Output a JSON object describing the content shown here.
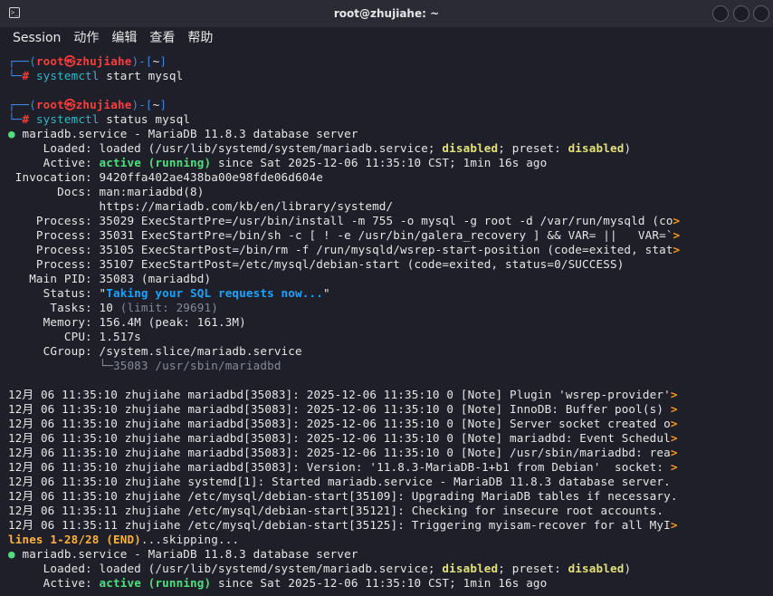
{
  "window": {
    "title": "root@zhujiahe: ~",
    "app_icon_glyph": ">_"
  },
  "menu": [
    "Session",
    "动作",
    "编辑",
    "查看",
    "帮助"
  ],
  "terminal": {
    "lines": [
      [
        {
          "t": "┌──(",
          "c": "blue"
        },
        {
          "t": "root㉿zhujiahe",
          "c": "red"
        },
        {
          "t": ")-[",
          "c": "blue"
        },
        {
          "t": "~",
          "c": ""
        },
        {
          "t": "]",
          "c": "blue"
        }
      ],
      [
        {
          "t": "└─",
          "c": "blue"
        },
        {
          "t": "# ",
          "c": "red"
        },
        {
          "t": "systemctl",
          "c": "cyan"
        },
        {
          "t": " start mysql",
          "c": ""
        }
      ],
      [],
      [
        {
          "t": "┌──(",
          "c": "blue"
        },
        {
          "t": "root㉿zhujiahe",
          "c": "red"
        },
        {
          "t": ")-[",
          "c": "blue"
        },
        {
          "t": "~",
          "c": ""
        },
        {
          "t": "]",
          "c": "blue"
        }
      ],
      [
        {
          "t": "└─",
          "c": "blue"
        },
        {
          "t": "# ",
          "c": "red"
        },
        {
          "t": "systemctl",
          "c": "cyan"
        },
        {
          "t": " status mysql",
          "c": ""
        }
      ],
      [
        {
          "t": "●",
          "c": "green"
        },
        {
          "t": " mariadb.service - MariaDB 11.8.3 database server",
          "c": ""
        }
      ],
      [
        {
          "t": "     Loaded: loaded (/usr/lib/systemd/system/mariadb.service; ",
          "c": ""
        },
        {
          "t": "disabled",
          "c": "yellowb"
        },
        {
          "t": "; preset: ",
          "c": ""
        },
        {
          "t": "disabled",
          "c": "yellowb"
        },
        {
          "t": ")",
          "c": ""
        }
      ],
      [
        {
          "t": "     Active: ",
          "c": ""
        },
        {
          "t": "active (running)",
          "c": "greenb"
        },
        {
          "t": " since Sat 2025-12-06 11:35:10 CST; 1min 16s ago",
          "c": ""
        }
      ],
      [
        {
          "t": " Invocation: 9420ffa402ae438ba00e98fde06d604e",
          "c": ""
        }
      ],
      [
        {
          "t": "       Docs: man:mariadbd(8)",
          "c": ""
        }
      ],
      [
        {
          "t": "             https://mariadb.com/kb/en/library/systemd/",
          "c": ""
        }
      ],
      [
        {
          "t": "    Process: 35029 ExecStartPre=/usr/bin/install -m 755 -o mysql -g root -d /var/run/mysqld (co",
          "c": ""
        },
        {
          "t": ">",
          "c": "orange"
        }
      ],
      [
        {
          "t": "    Process: 35031 ExecStartPre=/bin/sh -c [ ! -e /usr/bin/galera_recovery ] && VAR= ||   VAR=`",
          "c": ""
        },
        {
          "t": ">",
          "c": "orange"
        }
      ],
      [
        {
          "t": "    Process: 35105 ExecStartPost=/bin/rm -f /run/mysqld/wsrep-start-position (code=exited, stat",
          "c": ""
        },
        {
          "t": ">",
          "c": "orange"
        }
      ],
      [
        {
          "t": "    Process: 35107 ExecStartPost=/etc/mysql/debian-start (code=exited, status=0/SUCCESS)",
          "c": ""
        }
      ],
      [
        {
          "t": "   Main PID: 35083 (mariadbd)",
          "c": ""
        }
      ],
      [
        {
          "t": "     Status: \"",
          "c": ""
        },
        {
          "t": "Taking your SQL requests now...",
          "c": "hl"
        },
        {
          "t": "\"",
          "c": ""
        }
      ],
      [
        {
          "t": "      Tasks: 10 ",
          "c": ""
        },
        {
          "t": "(limit: 29691)",
          "c": "dim"
        }
      ],
      [
        {
          "t": "     Memory: 156.4M (peak: 161.3M)",
          "c": ""
        }
      ],
      [
        {
          "t": "        CPU: 1.517s",
          "c": ""
        }
      ],
      [
        {
          "t": "     CGroup: /system.slice/mariadb.service",
          "c": ""
        }
      ],
      [
        {
          "t": "             └─35083 /usr/sbin/mariadbd",
          "c": "dim"
        }
      ],
      [],
      [
        {
          "t": "12月 06 11:35:10 zhujiahe mariadbd[35083]: 2025-12-06 11:35:10 0 [Note] Plugin 'wsrep-provider'",
          "c": ""
        },
        {
          "t": ">",
          "c": "orange"
        }
      ],
      [
        {
          "t": "12月 06 11:35:10 zhujiahe mariadbd[35083]: 2025-12-06 11:35:10 0 [Note] InnoDB: Buffer pool(s) ",
          "c": ""
        },
        {
          "t": ">",
          "c": "orange"
        }
      ],
      [
        {
          "t": "12月 06 11:35:10 zhujiahe mariadbd[35083]: 2025-12-06 11:35:10 0 [Note] Server socket created o",
          "c": ""
        },
        {
          "t": ">",
          "c": "orange"
        }
      ],
      [
        {
          "t": "12月 06 11:35:10 zhujiahe mariadbd[35083]: 2025-12-06 11:35:10 0 [Note] mariadbd: Event Schedul",
          "c": ""
        },
        {
          "t": ">",
          "c": "orange"
        }
      ],
      [
        {
          "t": "12月 06 11:35:10 zhujiahe mariadbd[35083]: 2025-12-06 11:35:10 0 [Note] /usr/sbin/mariadbd: rea",
          "c": ""
        },
        {
          "t": ">",
          "c": "orange"
        }
      ],
      [
        {
          "t": "12月 06 11:35:10 zhujiahe mariadbd[35083]: Version: '11.8.3-MariaDB-1+b1 from Debian'  socket: ",
          "c": ""
        },
        {
          "t": ">",
          "c": "orange"
        }
      ],
      [
        {
          "t": "12月 06 11:35:10 zhujiahe systemd[1]: Started mariadb.service - MariaDB 11.8.3 database server.",
          "c": ""
        }
      ],
      [
        {
          "t": "12月 06 11:35:10 zhujiahe /etc/mysql/debian-start[35109]: Upgrading MariaDB tables if necessary.",
          "c": ""
        }
      ],
      [
        {
          "t": "12月 06 11:35:11 zhujiahe /etc/mysql/debian-start[35121]: Checking for insecure root accounts.",
          "c": ""
        }
      ],
      [
        {
          "t": "12月 06 11:35:11 zhujiahe /etc/mysql/debian-start[35125]: Triggering myisam-recover for all MyI",
          "c": ""
        },
        {
          "t": ">",
          "c": "orange"
        }
      ],
      [
        {
          "t": "lines 1-28/28 (END)",
          "c": "pager"
        },
        {
          "t": "...skipping...",
          "c": ""
        }
      ],
      [
        {
          "t": "●",
          "c": "green"
        },
        {
          "t": " mariadb.service - MariaDB 11.8.3 database server",
          "c": ""
        }
      ],
      [
        {
          "t": "     Loaded: loaded (/usr/lib/systemd/system/mariadb.service; ",
          "c": ""
        },
        {
          "t": "disabled",
          "c": "yellowb"
        },
        {
          "t": "; preset: ",
          "c": ""
        },
        {
          "t": "disabled",
          "c": "yellowb"
        },
        {
          "t": ")",
          "c": ""
        }
      ],
      [
        {
          "t": "     Active: ",
          "c": ""
        },
        {
          "t": "active (running)",
          "c": "greenb"
        },
        {
          "t": " since Sat 2025-12-06 11:35:10 CST; 1min 16s ago",
          "c": ""
        }
      ]
    ]
  }
}
